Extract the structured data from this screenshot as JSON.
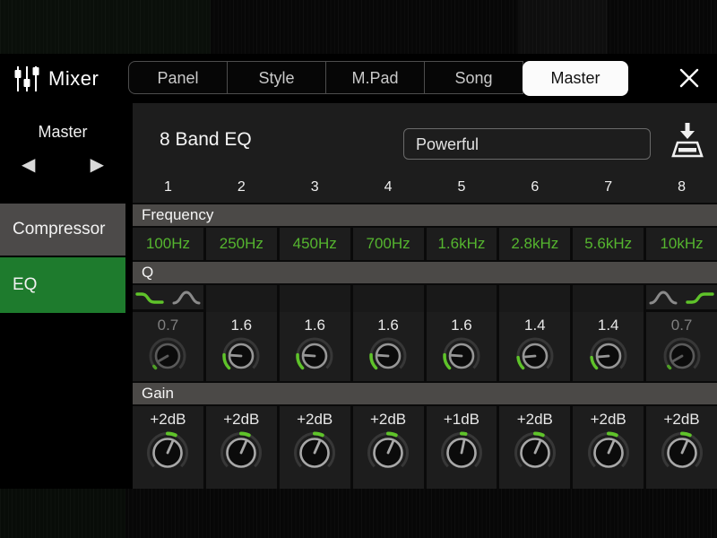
{
  "header": {
    "title": "Mixer",
    "tabs": [
      {
        "label": "Panel",
        "active": false
      },
      {
        "label": "Style",
        "active": false
      },
      {
        "label": "M.Pad",
        "active": false
      },
      {
        "label": "Song",
        "active": false
      },
      {
        "label": "Master",
        "active": true
      }
    ],
    "icons": {
      "app": "mixer-faders",
      "close": "close-x"
    }
  },
  "sidebar": {
    "group_label": "Master",
    "prev_label": "◀",
    "next_label": "▶",
    "items": [
      {
        "label": "Compressor",
        "active": false
      },
      {
        "label": "EQ",
        "active": true
      }
    ]
  },
  "main": {
    "title": "8 Band EQ",
    "preset": "Powerful",
    "icons": {
      "save": "save-to-disk"
    },
    "rows": {
      "frequency_label": "Frequency",
      "q_label": "Q",
      "gain_label": "Gain"
    },
    "bands": [
      {
        "number": "1",
        "freq": "100Hz",
        "q": "0.7",
        "q_dim": true,
        "gain": "+2dB",
        "q_icons": {
          "options": [
            "low-shelf",
            "peak"
          ],
          "selected": "low-shelf"
        }
      },
      {
        "number": "2",
        "freq": "250Hz",
        "q": "1.6",
        "q_dim": false,
        "gain": "+2dB"
      },
      {
        "number": "3",
        "freq": "450Hz",
        "q": "1.6",
        "q_dim": false,
        "gain": "+2dB"
      },
      {
        "number": "4",
        "freq": "700Hz",
        "q": "1.6",
        "q_dim": false,
        "gain": "+2dB"
      },
      {
        "number": "5",
        "freq": "1.6kHz",
        "q": "1.6",
        "q_dim": false,
        "gain": "+1dB"
      },
      {
        "number": "6",
        "freq": "2.8kHz",
        "q": "1.4",
        "q_dim": false,
        "gain": "+2dB"
      },
      {
        "number": "7",
        "freq": "5.6kHz",
        "q": "1.4",
        "q_dim": false,
        "gain": "+2dB"
      },
      {
        "number": "8",
        "freq": "10kHz",
        "q": "0.7",
        "q_dim": true,
        "gain": "+2dB",
        "q_icons": {
          "options": [
            "peak",
            "high-shelf"
          ],
          "selected": "high-shelf"
        }
      }
    ],
    "colors": {
      "accent_green": "#55b52f",
      "selected_green": "#1e7b2d",
      "knob_green": "#5fc32a"
    }
  }
}
